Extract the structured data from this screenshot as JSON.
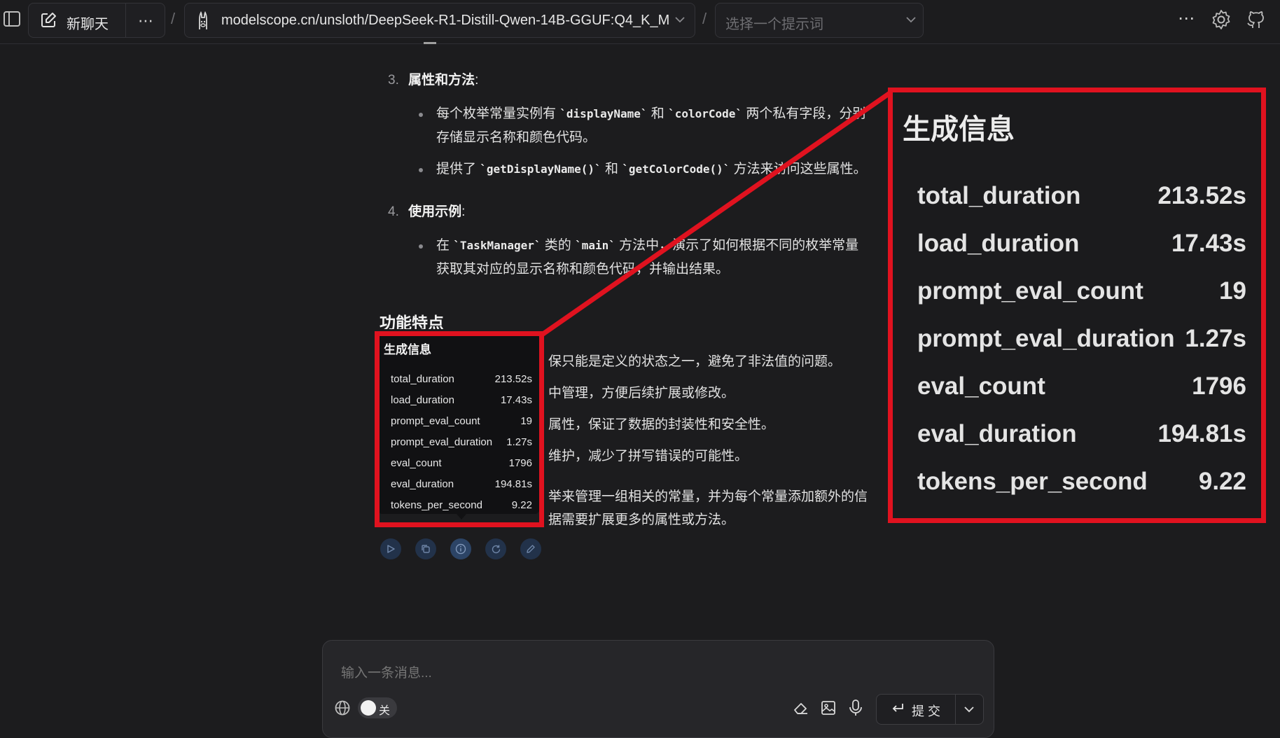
{
  "topbar": {
    "new_chat_label": "新聊天",
    "model_name": "modelscope.cn/unsloth/DeepSeek-R1-Distill-Qwen-14B-GGUF:Q4_K_M",
    "slash": "/",
    "prompt_placeholder": "选择一个提示词"
  },
  "message": {
    "item3": {
      "number": "3.",
      "title": "属性和方法",
      "colon": ":"
    },
    "item3_b1_line1": {
      "a": "每个枚举常量实例有 ",
      "code1": "`displayName`",
      "b": " 和 ",
      "code2": "`colorCode`",
      "c": " 两个私有字段，分别"
    },
    "item3_b1_line2": "存储显示名称和颜色代码。",
    "item3_b2": {
      "a": "提供了 ",
      "code1": "`getDisplayName()`",
      "b": " 和 ",
      "code2": "`getColorCode()`",
      "c": " 方法来访问这些属性。"
    },
    "item4": {
      "number": "4.",
      "title": "使用示例",
      "colon": ":"
    },
    "item4_b1_line1": {
      "a": "在 ",
      "code1": "`TaskManager`",
      "b": " 类的 ",
      "code2": "`main`",
      "c": " 方法中，演示了如何根据不同的枚举常量"
    },
    "item4_b1_line2": "获取其对应的显示名称和颜色代码，并输出结果。",
    "features_heading": "功能特点",
    "partial_lines": [
      "保只能是定义的状态之一，避免了非法值的问题。",
      "中管理，方便后续扩展或修改。",
      "属性，保证了数据的封装性和安全性。",
      "维护，减少了拼写错误的可能性。",
      "举来管理一组相关的常量，并为每个常量添加额外的信",
      "据需要扩展更多的属性或方法。"
    ]
  },
  "generation_info": {
    "title": "生成信息",
    "rows": [
      {
        "key": "total_duration",
        "value": "213.52s"
      },
      {
        "key": "load_duration",
        "value": "17.43s"
      },
      {
        "key": "prompt_eval_count",
        "value": "19"
      },
      {
        "key": "prompt_eval_duration",
        "value": "1.27s"
      },
      {
        "key": "eval_count",
        "value": "1796"
      },
      {
        "key": "eval_duration",
        "value": "194.81s"
      },
      {
        "key": "tokens_per_second",
        "value": "9.22"
      }
    ]
  },
  "composer": {
    "placeholder": "输入一条消息...",
    "toggle_label": "关",
    "submit_label": "提 交"
  },
  "colors": {
    "highlight": "#e0121f",
    "background": "#1c1c1e"
  }
}
